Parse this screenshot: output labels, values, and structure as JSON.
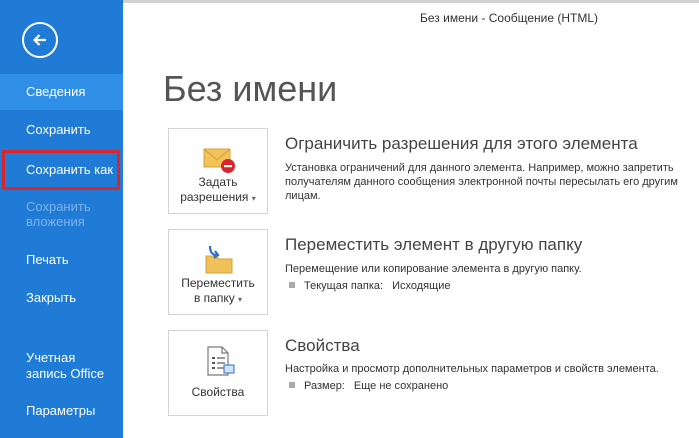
{
  "window": {
    "title": "Без имени - Сообщение (HTML)"
  },
  "sidebar": {
    "back_icon": "back-arrow-icon",
    "items": [
      {
        "label": "Сведения"
      },
      {
        "label": "Сохранить"
      },
      {
        "label": "Сохранить как"
      },
      {
        "label": "Сохранить вложения"
      },
      {
        "label": "Печать"
      },
      {
        "label": "Закрыть"
      },
      {
        "label": "Учетная запись Office"
      },
      {
        "label": "Параметры"
      }
    ]
  },
  "main": {
    "title": "Без имени",
    "sections": [
      {
        "button_line1": "Задать",
        "button_line2": "разрешения",
        "icon": "envelope-restrict-icon",
        "title": "Ограничить разрешения для этого элемента",
        "description": "Установка ограничений для данного элемента. Например, можно запретить получателям данного сообщения электронной почты пересылать его другим лицам."
      },
      {
        "button_line1": "Переместить",
        "button_line2": "в папку",
        "icon": "move-to-folder-icon",
        "title": "Переместить элемент в другую папку",
        "description": "Перемещение или копирование элемента в другую папку.",
        "prop_label": "Текущая папка:",
        "prop_value": "Исходящие"
      },
      {
        "button_line1": "Свойства",
        "icon": "properties-icon",
        "title": "Свойства",
        "description": "Настройка и просмотр дополнительных параметров и свойств элемента.",
        "prop_label": "Размер:",
        "prop_value": "Еще не сохранено"
      }
    ]
  },
  "colors": {
    "sidebar": "#1f7bd6",
    "sidebar_active": "#2f8fe6",
    "highlight": "#d9262d"
  }
}
